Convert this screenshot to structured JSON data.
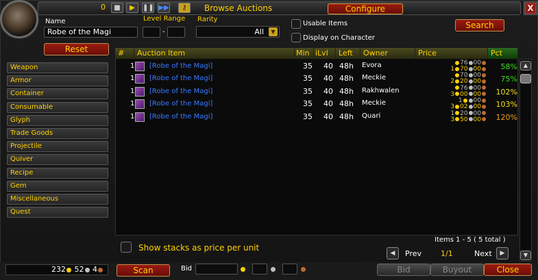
{
  "title": {
    "count": "0",
    "text": "Browse Auctions",
    "configure_label": "Configure",
    "close_label": "X"
  },
  "filters": {
    "name_label": "Name",
    "name_value": "Robe of the Magi",
    "level_range_label": "Level Range",
    "level_min": "",
    "level_max": "",
    "level_sep": "-",
    "rarity_label": "Rarity",
    "rarity_value": "All",
    "usable_items_label": "Usable Items",
    "display_on_character_label": "Display on Character",
    "reset_label": "Reset",
    "search_label": "Search"
  },
  "categories": [
    "Weapon",
    "Armor",
    "Container",
    "Consumable",
    "Glyph",
    "Trade Goods",
    "Projectile",
    "Quiver",
    "Recipe",
    "Gem",
    "Miscellaneous",
    "Quest"
  ],
  "columns": {
    "num": "#",
    "item": "Auction Item",
    "min": "Min",
    "ilvl": "iLvl",
    "left": "Left",
    "owner": "Owner",
    "price": "Price",
    "pct": "Pct"
  },
  "rows": [
    {
      "qty": "1",
      "item": "[Robe of the Magi]",
      "min": "35",
      "ilvl": "40",
      "left": "48h",
      "owner": "Evora",
      "bid": {
        "g": "",
        "s": "76",
        "c": "00"
      },
      "buyout": {
        "g": "1",
        "s": "70",
        "c": "00"
      },
      "pct": "58%",
      "pct_color": "#3adf1a"
    },
    {
      "qty": "1",
      "item": "[Robe of the Magi]",
      "min": "35",
      "ilvl": "40",
      "left": "48h",
      "owner": "Meckie",
      "bid": {
        "g": "",
        "s": "70",
        "c": "00"
      },
      "buyout": {
        "g": "2",
        "s": "20",
        "c": "00"
      },
      "pct": "75%",
      "pct_color": "#3adf1a"
    },
    {
      "qty": "1",
      "item": "[Robe of the Magi]",
      "min": "35",
      "ilvl": "40",
      "left": "48h",
      "owner": "Rakhwalen",
      "bid": {
        "g": "",
        "s": "76",
        "c": "00"
      },
      "buyout": {
        "g": "3",
        "s": "00",
        "c": "00"
      },
      "pct": "102%",
      "pct_color": "#f0e020"
    },
    {
      "qty": "1",
      "item": "[Robe of the Magi]",
      "min": "35",
      "ilvl": "40",
      "left": "48h",
      "owner": "Meckie",
      "bid": {
        "g": "1",
        "s": "",
        "c": "00"
      },
      "buyout": {
        "g": "3",
        "s": "02",
        "c": "00"
      },
      "pct": "103%",
      "pct_color": "#f0e020"
    },
    {
      "qty": "1",
      "item": "[Robe of the Magi]",
      "min": "35",
      "ilvl": "40",
      "left": "48h",
      "owner": "Quari",
      "bid": {
        "g": "1",
        "s": "20",
        "c": "00"
      },
      "buyout": {
        "g": "3",
        "s": "50",
        "c": "00"
      },
      "pct": "120%",
      "pct_color": "#f0a020"
    }
  ],
  "footer": {
    "stacks_label": "Show stacks as price per unit",
    "items_count": "Items 1 - 5  ( 5 total )",
    "prev_label": "Prev",
    "page": "1/1",
    "next_label": "Next"
  },
  "bottom": {
    "gold": "232",
    "silver": "52",
    "copper": "4",
    "scan_label": "Scan",
    "bid_label": "Bid",
    "bid_button": "Bid",
    "buyout_button": "Buyout",
    "close_button": "Close"
  },
  "colors": {
    "gold": "#ffd100",
    "item_blue": "#3a7aff",
    "button_red": "#8a1a10"
  }
}
